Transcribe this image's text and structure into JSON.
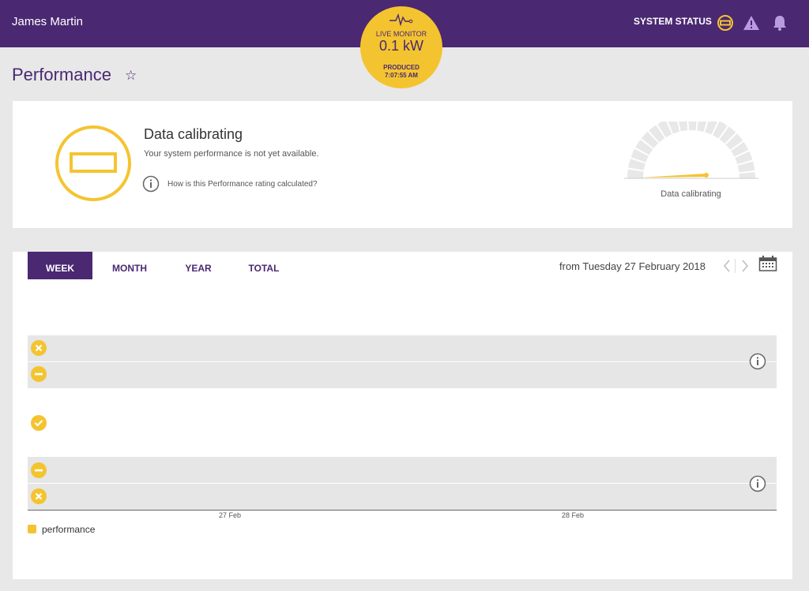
{
  "header": {
    "user_name": "James Martin",
    "system_status_label": "SYSTEM STATUS",
    "icons": [
      "status-minus-icon",
      "warning-icon",
      "bell-icon"
    ],
    "colors": {
      "primary": "#4a2872",
      "accent": "#f4c430"
    }
  },
  "live_monitor": {
    "label": "LIVE MONITOR",
    "value": "0.1 kW",
    "produced_label": "PRODUCED",
    "time": "7:07:55 AM"
  },
  "page": {
    "title": "Performance"
  },
  "calibration": {
    "title": "Data calibrating",
    "subtitle": "Your system performance is not yet available.",
    "info_link": "How is this Performance rating calculated?",
    "gauge_label": "Data calibrating"
  },
  "chart": {
    "tabs": [
      {
        "label": "WEEK",
        "active": true
      },
      {
        "label": "MONTH",
        "active": false
      },
      {
        "label": "YEAR",
        "active": false
      },
      {
        "label": "TOTAL",
        "active": false
      }
    ],
    "date_range": "from Tuesday 27 February 2018",
    "x_ticks": [
      "27 Feb",
      "28 Feb"
    ],
    "legend": "performance",
    "rows": [
      "error-icon",
      "minus-icon",
      "check-icon",
      "minus-icon",
      "error-icon"
    ]
  }
}
